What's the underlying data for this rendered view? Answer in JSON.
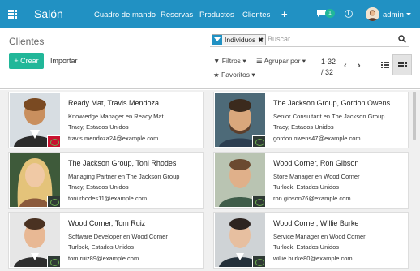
{
  "navbar": {
    "brand": "Salón",
    "menu": [
      "Cuadro de mando",
      "Reservas",
      "Productos",
      "Clientes"
    ],
    "plus": "+",
    "messages_badge": "1",
    "user": "admin"
  },
  "control_panel": {
    "title": "Clientes",
    "create_label": "Crear",
    "import_label": "Importar",
    "search": {
      "facet": "Individuos",
      "placeholder": "Buscar..."
    },
    "filters_label": "Filtros",
    "groupby_label": "Agrupar por",
    "favorites_label": "Favoritos",
    "pager_range": "1-32",
    "pager_total": "/ 32"
  },
  "colors": {
    "navbar": "#2191c3",
    "create_button": "#21b799",
    "kanban_bg": "#f0f0f0"
  },
  "cards": [
    {
      "title": "Ready Mat, Travis Mendoza",
      "job": "Knowledge Manager en Ready Mat",
      "location": "Tracy, Estados Unidos",
      "email": "travis.mendoza24@example.com"
    },
    {
      "title": "The Jackson Group, Gordon Owens",
      "job": "Senior Consultant en The Jackson Group",
      "location": "Tracy, Estados Unidos",
      "email": "gordon.owens47@example.com"
    },
    {
      "title": "The Jackson Group, Toni Rhodes",
      "job": "Managing Partner en The Jackson Group",
      "location": "Tracy, Estados Unidos",
      "email": "toni.rhodes11@example.com"
    },
    {
      "title": "Wood Corner, Ron Gibson",
      "job": "Store Manager en Wood Corner",
      "location": "Turlock, Estados Unidos",
      "email": "ron.gibson76@example.com"
    },
    {
      "title": "Wood Corner, Tom Ruiz",
      "job": "Software Developer en Wood Corner",
      "location": "Turlock, Estados Unidos",
      "email": "tom.ruiz89@example.com"
    },
    {
      "title": "Wood Corner, Willie Burke",
      "job": "Service Manager en Wood Corner",
      "location": "Turlock, Estados Unidos",
      "email": "willie.burke80@example.com"
    }
  ]
}
